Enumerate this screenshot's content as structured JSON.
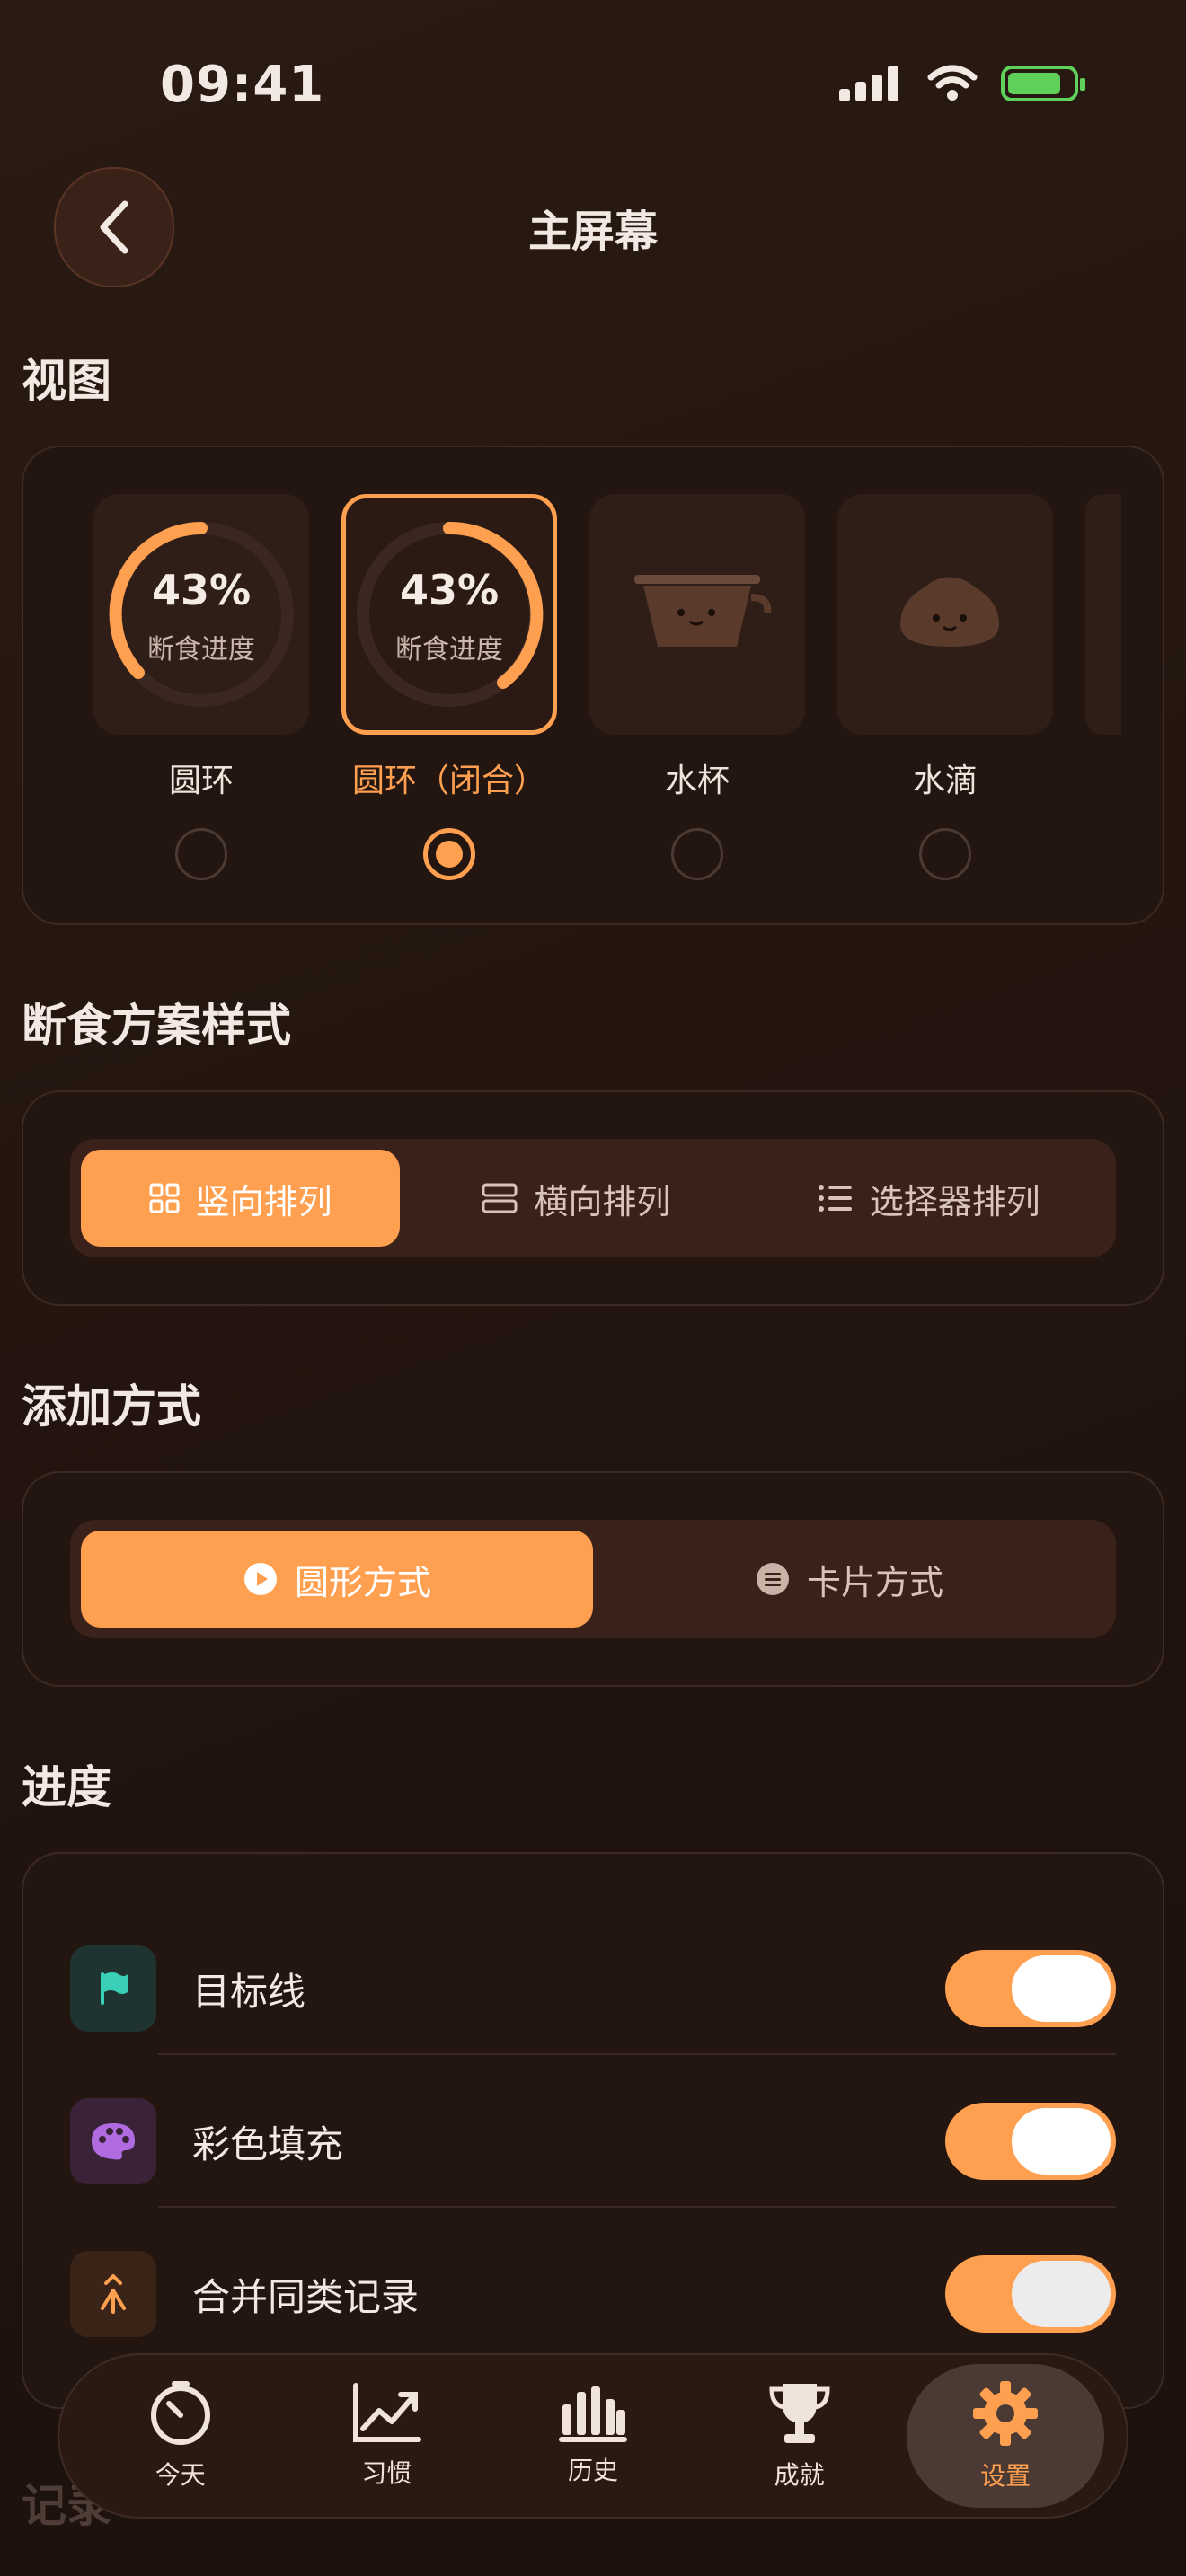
{
  "status": {
    "time": "09:41"
  },
  "header": {
    "title": "主屏幕"
  },
  "sections": {
    "view": "视图",
    "plan_style": "断食方案样式",
    "add_mode": "添加方式",
    "progress": "进度",
    "records": "记录"
  },
  "views": [
    {
      "label": "圆环",
      "percent": "43%",
      "sub": "断食进度",
      "selected": false
    },
    {
      "label": "圆环（闭合）",
      "percent": "43%",
      "sub": "断食进度",
      "selected": true
    },
    {
      "label": "水杯",
      "selected": false
    },
    {
      "label": "水滴",
      "selected": false
    }
  ],
  "plan_style": {
    "options": [
      "竖向排列",
      "横向排列",
      "选择器排列"
    ],
    "active": 0
  },
  "add_mode": {
    "options": [
      "圆形方式",
      "卡片方式"
    ],
    "active": 0
  },
  "progress_rows": [
    {
      "label": "目标线",
      "icon": "flag-icon",
      "color": "#3ad0b8",
      "on": true
    },
    {
      "label": "彩色填充",
      "icon": "palette-icon",
      "color": "#b06be0",
      "on": true
    },
    {
      "label": "合并同类记录",
      "icon": "merge-icon",
      "color": "#ff9f50",
      "on": true
    }
  ],
  "tabs": [
    {
      "label": "今天",
      "icon": "timer-icon"
    },
    {
      "label": "习惯",
      "icon": "chart-line-icon"
    },
    {
      "label": "历史",
      "icon": "bar-chart-icon"
    },
    {
      "label": "成就",
      "icon": "trophy-icon"
    },
    {
      "label": "设置",
      "icon": "gear-icon",
      "active": true
    }
  ],
  "colors": {
    "accent": "#ff9f50",
    "background": "#24150f"
  }
}
